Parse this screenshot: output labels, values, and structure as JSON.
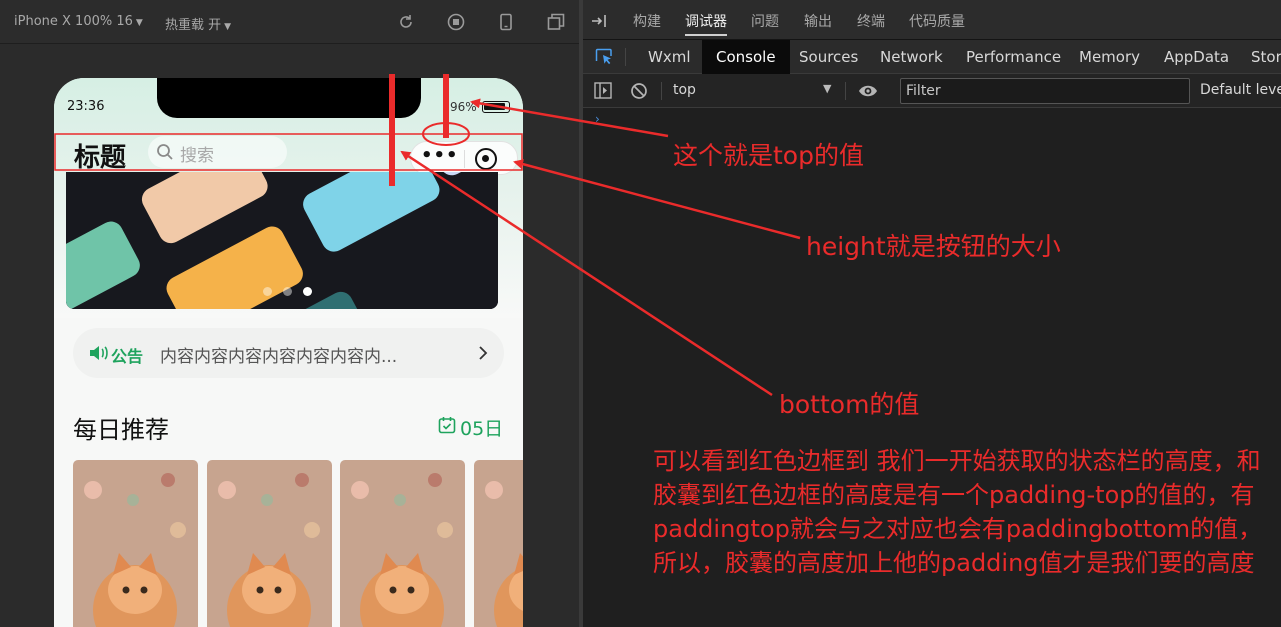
{
  "simulator": {
    "device_label": "iPhone X 100% 16",
    "hot_reload_label": "热重载 开"
  },
  "phone": {
    "status_time": "23:36",
    "battery_text": "96%",
    "nav_title": "标题",
    "search_placeholder": "搜索",
    "banner_dots": 3,
    "notice_label": "公告",
    "notice_text": "内容内容内容内容内容内容内...",
    "daily_title": "每日推荐",
    "daily_date": "05日",
    "cards": 4
  },
  "devtools": {
    "top_tabs": [
      "构建",
      "调试器",
      "问题",
      "输出",
      "终端",
      "代码质量"
    ],
    "active_top_tab": "调试器",
    "panel_tabs": [
      "Wxml",
      "Console",
      "Sources",
      "Network",
      "Performance",
      "Memory",
      "AppData",
      "Stora"
    ],
    "active_panel_tab": "Console",
    "context": "top",
    "filter_placeholder": "Filter",
    "levels": "Default levels",
    "prompt": "›"
  },
  "annotations": {
    "top_note": "这个就是top的值",
    "height_note": "height就是按钮的大小",
    "bottom_note": "bottom的值",
    "paragraph": "可以看到红色边框到 我们一开始获取的状态栏的高度，和胶囊到红色边框的高度是有一个padding-top的值的，有paddingtop就会与之对应也会有paddingbottom的值，所以，胶囊的高度加上他的padding值才是我们要的高度"
  },
  "colors": {
    "annotation_red": "#ea2b2b",
    "accent_green": "#1ea35d"
  }
}
